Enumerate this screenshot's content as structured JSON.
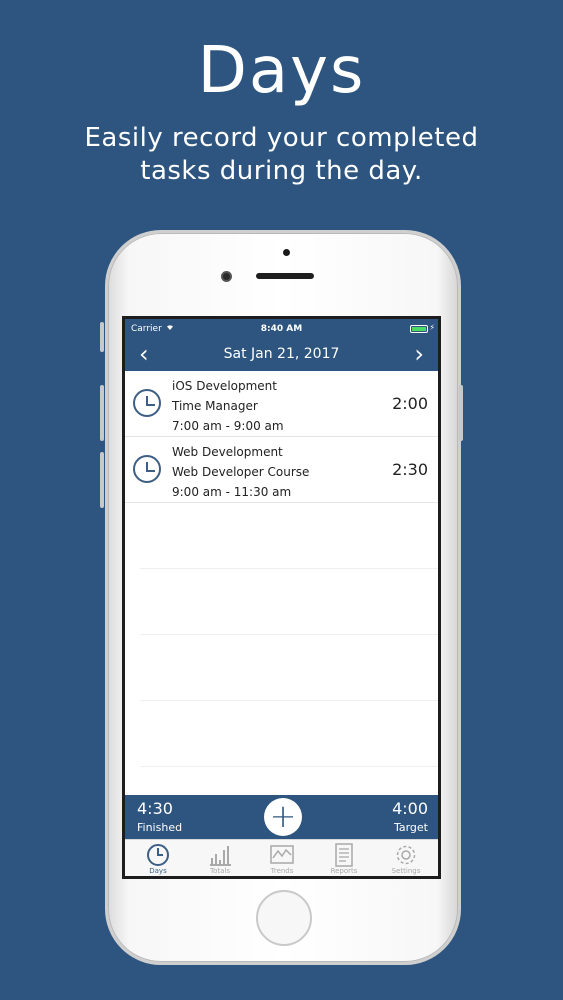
{
  "hero": {
    "title": "Days",
    "subtitle_line1": "Easily record your completed",
    "subtitle_line2": "tasks during the day."
  },
  "status_bar": {
    "carrier": "Carrier",
    "time": "8:40 AM"
  },
  "nav": {
    "title": "Sat Jan 21, 2017",
    "back_glyph": "‹",
    "forward_glyph": "›"
  },
  "entries": [
    {
      "project": "iOS Development",
      "task": "Time Manager",
      "time_range": "7:00 am - 9:00 am",
      "duration": "2:00"
    },
    {
      "project": "Web Development",
      "task": "Web Developer Course",
      "time_range": "9:00 am - 11:30 am",
      "duration": "2:30"
    }
  ],
  "summary": {
    "finished_value": "4:30",
    "finished_label": "Finished",
    "add_glyph": "+",
    "target_value": "4:00",
    "target_label": "Target"
  },
  "tabs": [
    {
      "label": "Days",
      "icon": "clock-icon",
      "active": true
    },
    {
      "label": "Totals",
      "icon": "bar-chart-icon",
      "active": false
    },
    {
      "label": "Trends",
      "icon": "line-chart-icon",
      "active": false
    },
    {
      "label": "Reports",
      "icon": "document-icon",
      "active": false
    },
    {
      "label": "Settings",
      "icon": "gear-icon",
      "active": false
    }
  ],
  "colors": {
    "brand": "#2d557f",
    "battery": "#4cd964",
    "tab_active": "#3d5f85",
    "tab_inactive": "#a9a9a9"
  }
}
